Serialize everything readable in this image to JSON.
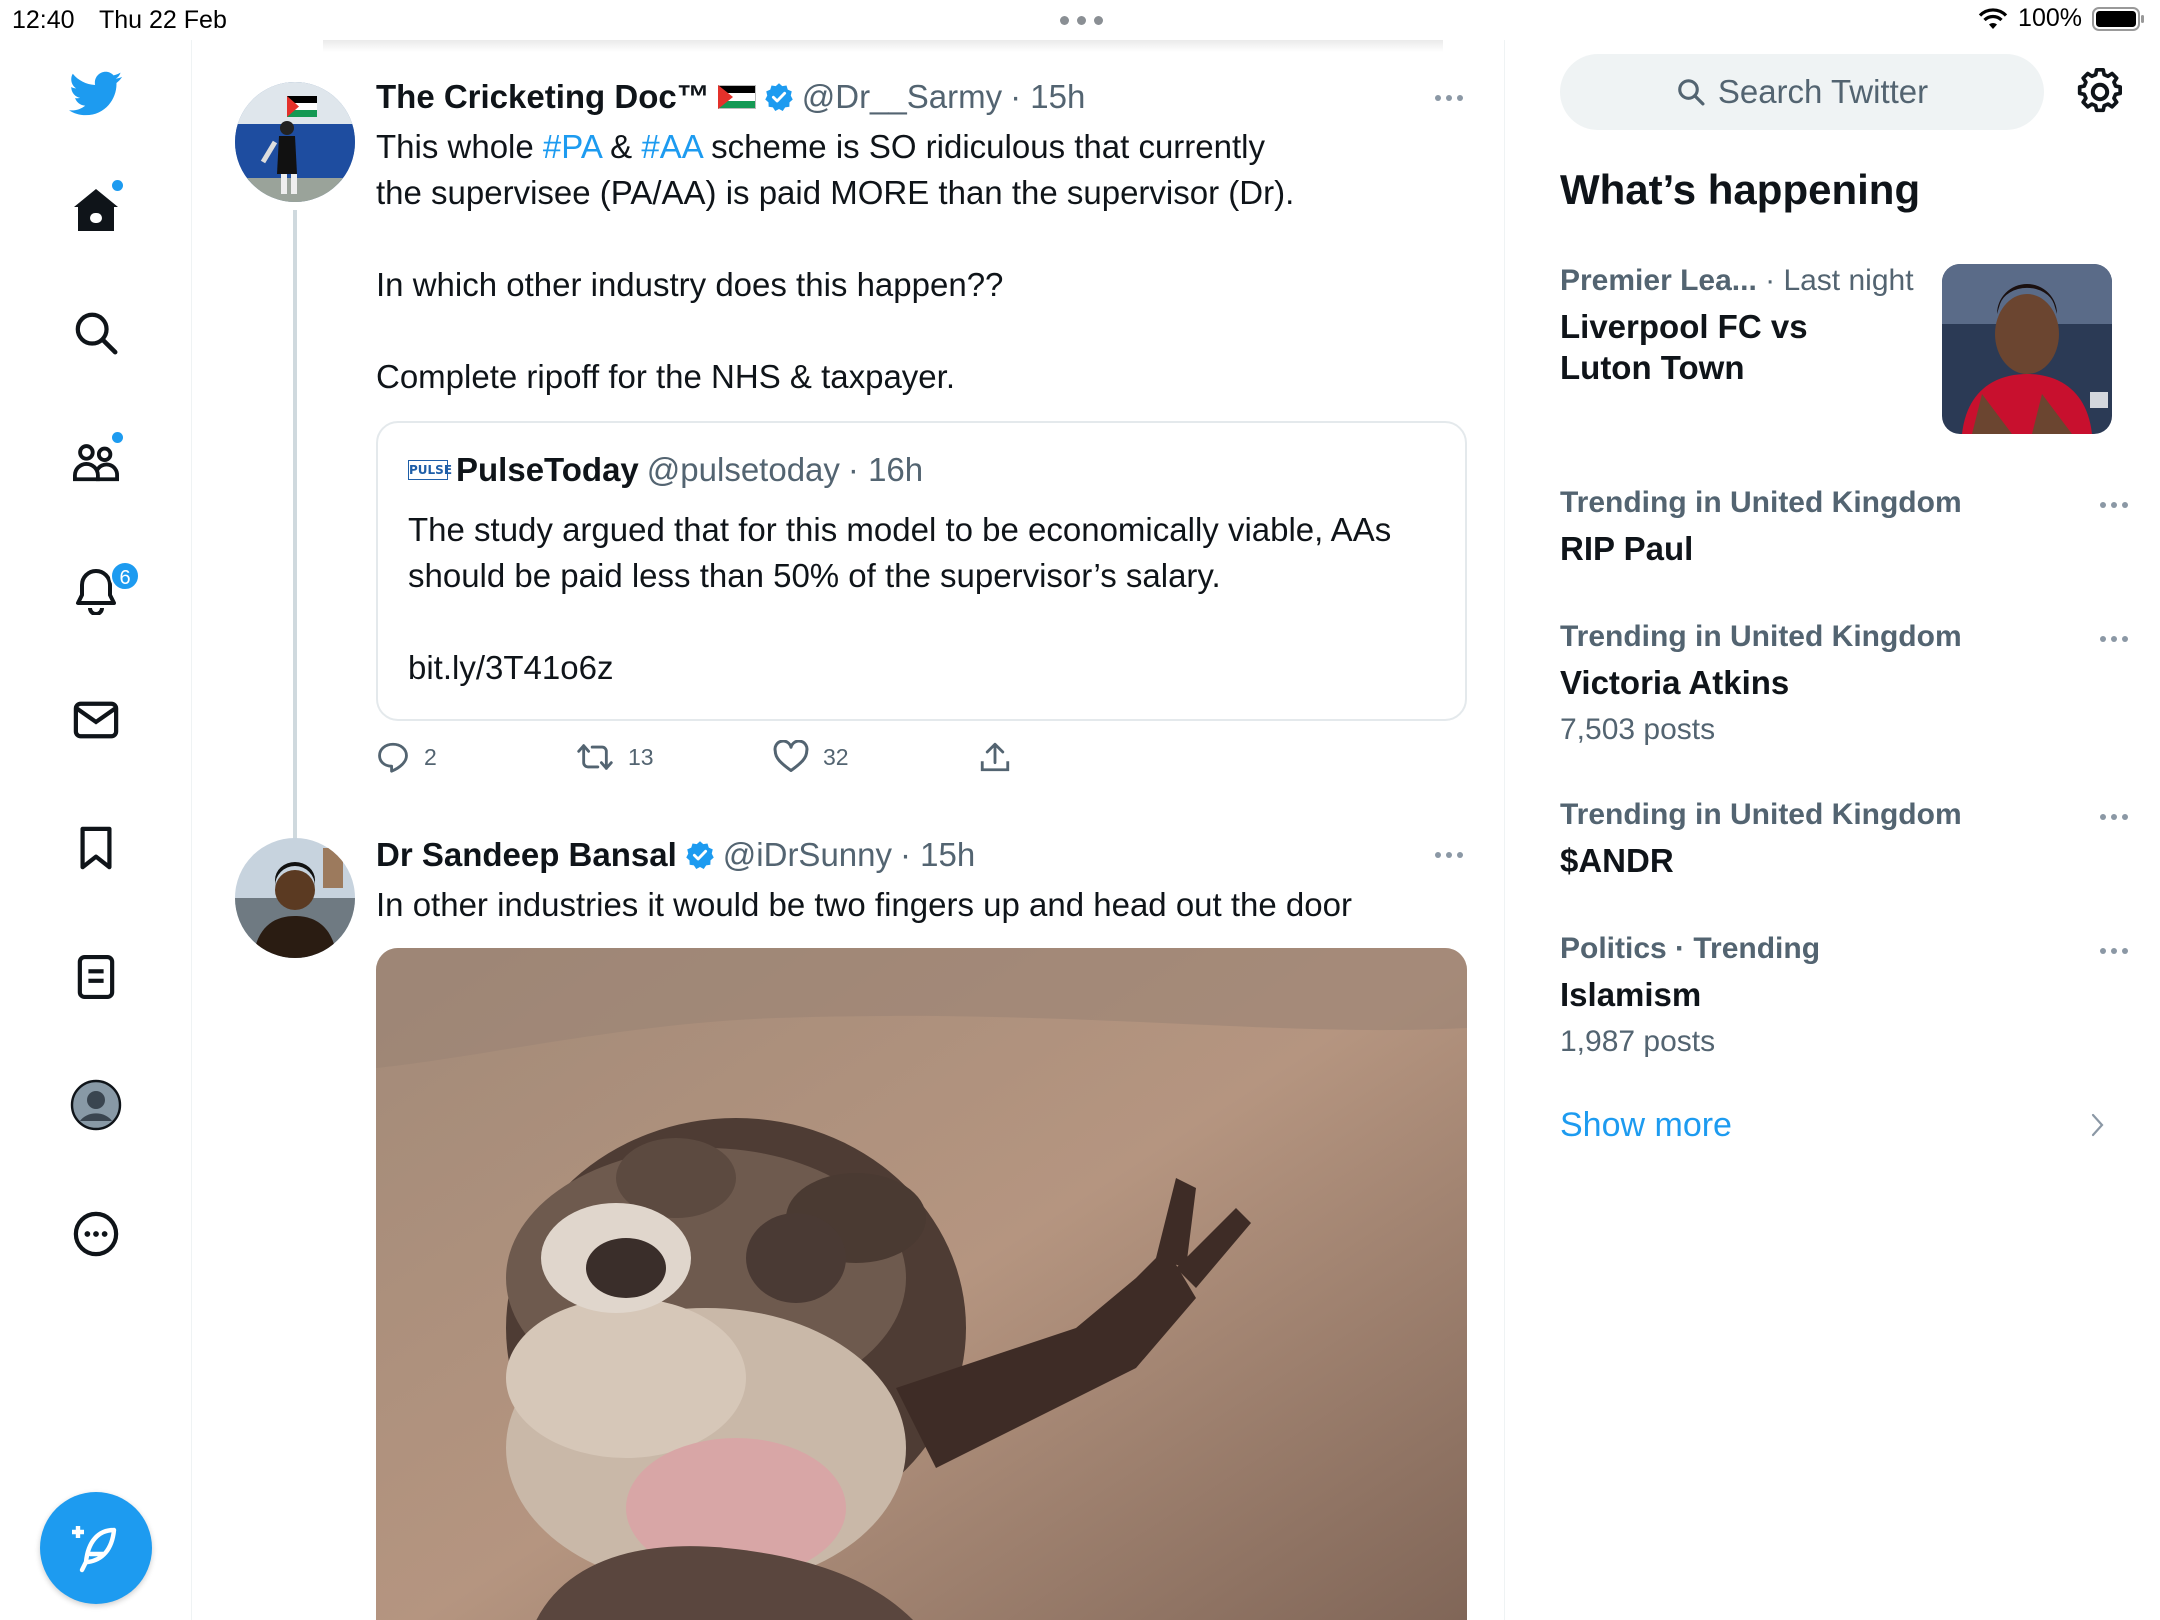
{
  "status_bar": {
    "time": "12:40",
    "date": "Thu 22 Feb",
    "battery": "100%"
  },
  "nav": {
    "notifications_badge": "6",
    "items": [
      "twitter-logo",
      "home-icon",
      "search-icon",
      "communities-icon",
      "notifications-icon",
      "messages-icon",
      "bookmarks-icon",
      "lists-icon",
      "profile-icon",
      "more-icon"
    ],
    "accent": "#1d9bf0"
  },
  "tweets": [
    {
      "name": "The Cricketing Doc™",
      "flag": "🇵🇸",
      "handle": "@Dr__Sarmy",
      "time": "· 15h",
      "text_part1": "This whole ",
      "hashtag1": "#PA",
      "text_part2": " & ",
      "hashtag2": "#AA",
      "text_part3": " scheme is SO ridiculous that currently",
      "text_line2": "the supervisee (PA/AA) is paid MORE than the supervisor (Dr).",
      "text_para2": "In which other industry does this happen??",
      "text_para3": "Complete ripoff for the NHS & taxpayer.",
      "quote": {
        "logo_text": "PULSE",
        "name": "PulseToday",
        "handle": "@pulsetoday",
        "time": "· 16h",
        "text": "The study argued that for this model to be economically viable, AAs\nshould be paid less than 50% of the supervisor’s salary.",
        "link": "bit.ly/3T41o6z"
      },
      "replies": "2",
      "retweets": "13",
      "likes": "32"
    },
    {
      "name": "Dr Sandeep Bansal",
      "handle": "@iDrSunny",
      "time": "· 15h",
      "text": "In other industries it would be two fingers up and head out the door"
    }
  ],
  "sidebar": {
    "search_placeholder": "Search Twitter",
    "section_title": "What’s happening",
    "trends": [
      {
        "context": "Premier Lea...",
        "context_extra": " · Last night",
        "title": "Liverpool FC vs\nLuton Town",
        "count": ""
      },
      {
        "context": "Trending in United Kingdom",
        "context_extra": "",
        "title": "RIP Paul",
        "count": ""
      },
      {
        "context": "Trending in United Kingdom",
        "context_extra": "",
        "title": "Victoria Atkins",
        "count": "7,503 posts"
      },
      {
        "context": "Trending in United Kingdom",
        "context_extra": "",
        "title": "$ANDR",
        "count": ""
      },
      {
        "context": "Politics · Trending",
        "context_extra": "",
        "title": "Islamism",
        "count": "1,987 posts"
      }
    ],
    "show_more": "Show more"
  }
}
